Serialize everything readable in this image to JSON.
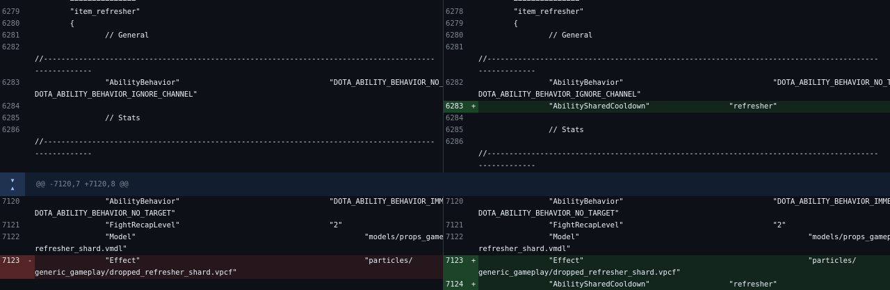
{
  "hunk_header": "@@ -7120,7 +7120,8 @@",
  "left": {
    "block1": [
      {
        "ln": "",
        "code": "        ===============",
        "type": "ctx"
      },
      {
        "ln": "6279",
        "code": "        \"item_refresher\"",
        "type": "ctx"
      },
      {
        "ln": "6280",
        "code": "        {",
        "type": "ctx"
      },
      {
        "ln": "6281",
        "code": "                // General",
        "type": "ctx"
      },
      {
        "ln": "6282",
        "code": "",
        "type": "ctx"
      },
      {
        "ln": "",
        "code": "//-----------------------------------------------------------------------------------------",
        "type": "ctx"
      },
      {
        "ln": "",
        "code": "-------------",
        "type": "ctx"
      },
      {
        "ln": "6283",
        "code": "                \"AbilityBehavior\"                                  \"DOTA_ABILITY_BEHAVIOR_NO_TARGET |",
        "type": "ctx"
      },
      {
        "ln": "",
        "code": "DOTA_ABILITY_BEHAVIOR_IGNORE_CHANNEL\"",
        "type": "ctx"
      },
      {
        "ln": "",
        "code": "",
        "type": "blank"
      },
      {
        "ln": "6284",
        "code": "",
        "type": "ctx"
      },
      {
        "ln": "6285",
        "code": "                // Stats",
        "type": "ctx"
      },
      {
        "ln": "6286",
        "code": "",
        "type": "ctx"
      },
      {
        "ln": "",
        "code": "//-----------------------------------------------------------------------------------------",
        "type": "ctx"
      },
      {
        "ln": "",
        "code": "-------------",
        "type": "ctx"
      }
    ],
    "block2": [
      {
        "ln": "7120",
        "code": "                \"AbilityBehavior\"                                  \"DOTA_ABILITY_BEHAVIOR_IMMEDIATE |",
        "type": "ctx"
      },
      {
        "ln": "",
        "code": "DOTA_ABILITY_BEHAVIOR_NO_TARGET\"",
        "type": "ctx"
      },
      {
        "ln": "7121",
        "code": "                \"FightRecapLevel\"                                  \"2\"",
        "type": "ctx"
      },
      {
        "ln": "7122",
        "code": "                \"Model\"                                                    \"models/props_gameplay/",
        "type": "ctx"
      },
      {
        "ln": "",
        "code": "refresher_shard.vmdl\"",
        "type": "ctx"
      },
      {
        "ln": "7123",
        "mk": "-",
        "code": "                \"Effect\"                                                   \"particles/",
        "type": "del"
      },
      {
        "ln": "",
        "code": "generic_gameplay/dropped_refresher_shard.vpcf\"",
        "type": "del"
      },
      {
        "ln": "",
        "code": "",
        "type": "blank"
      }
    ]
  },
  "right": {
    "block1": [
      {
        "ln": "",
        "code": "        ===============",
        "type": "ctx"
      },
      {
        "ln": "6278",
        "code": "        \"item_refresher\"",
        "type": "ctx"
      },
      {
        "ln": "6279",
        "code": "        {",
        "type": "ctx"
      },
      {
        "ln": "6280",
        "code": "                // General",
        "type": "ctx"
      },
      {
        "ln": "6281",
        "code": "",
        "type": "ctx"
      },
      {
        "ln": "",
        "code": "//-----------------------------------------------------------------------------------------",
        "type": "ctx"
      },
      {
        "ln": "",
        "code": "-------------",
        "type": "ctx"
      },
      {
        "ln": "6282",
        "code": "                \"AbilityBehavior\"                                  \"DOTA_ABILITY_BEHAVIOR_NO_TARGET |",
        "type": "ctx"
      },
      {
        "ln": "",
        "code": "DOTA_ABILITY_BEHAVIOR_IGNORE_CHANNEL\"",
        "type": "ctx"
      },
      {
        "ln": "6283",
        "mk": "+",
        "code": "                \"AbilitySharedCooldown\"                  \"refresher\"",
        "type": "add"
      },
      {
        "ln": "6284",
        "code": "",
        "type": "ctx"
      },
      {
        "ln": "6285",
        "code": "                // Stats",
        "type": "ctx"
      },
      {
        "ln": "6286",
        "code": "",
        "type": "ctx"
      },
      {
        "ln": "",
        "code": "//-----------------------------------------------------------------------------------------",
        "type": "ctx"
      },
      {
        "ln": "",
        "code": "-------------",
        "type": "ctx"
      }
    ],
    "block2": [
      {
        "ln": "7120",
        "code": "                \"AbilityBehavior\"                                  \"DOTA_ABILITY_BEHAVIOR_IMMEDIATE |",
        "type": "ctx"
      },
      {
        "ln": "",
        "code": "DOTA_ABILITY_BEHAVIOR_NO_TARGET\"",
        "type": "ctx"
      },
      {
        "ln": "7121",
        "code": "                \"FightRecapLevel\"                                  \"2\"",
        "type": "ctx"
      },
      {
        "ln": "7122",
        "code": "                \"Model\"                                                    \"models/props_gameplay/",
        "type": "ctx"
      },
      {
        "ln": "",
        "code": "refresher_shard.vmdl\"",
        "type": "ctx"
      },
      {
        "ln": "7123",
        "mk": "+",
        "code": "                \"Effect\"                                                   \"particles/",
        "type": "add"
      },
      {
        "ln": "",
        "code": "generic_gameplay/dropped_refresher_shard.vpcf\"",
        "type": "add"
      },
      {
        "ln": "7124",
        "mk": "+",
        "code": "                \"AbilitySharedCooldown\"                  \"refresher\"",
        "type": "add"
      }
    ]
  },
  "colors": {
    "bg": "#0d1117",
    "add": "#12261e",
    "del": "#25171c",
    "hunk": "#121d2f"
  },
  "icons": {
    "expand_down": "chevron-down-icon",
    "expand_up": "chevron-up-icon"
  }
}
